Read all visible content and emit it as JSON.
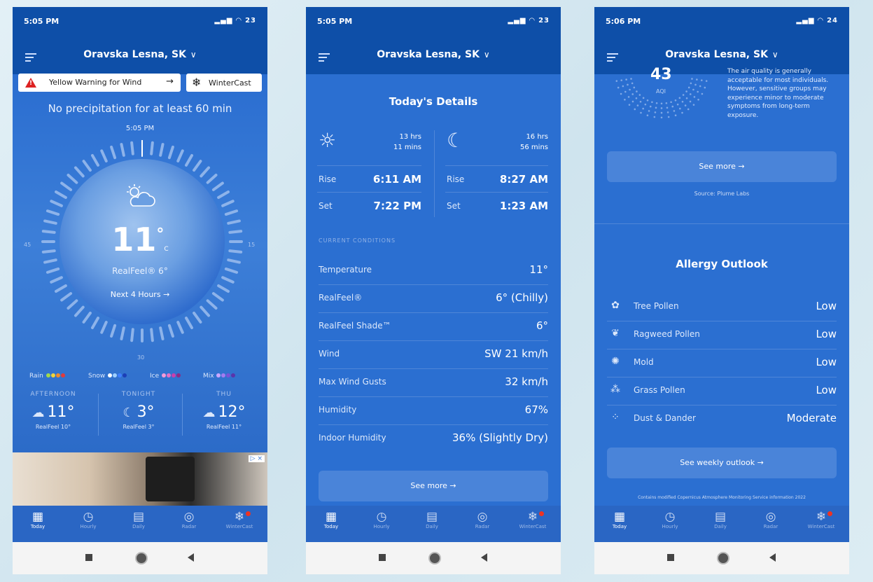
{
  "phones": [
    {
      "status_time": "5:05 PM",
      "battery": "23",
      "location": "Oravska Lesna, SK",
      "warning_label": "Yellow Warning for Wind",
      "wintercast_label": "WinterCast",
      "precip_text": "No precipitation for at least 60 min",
      "dial_time": "5:05 PM",
      "dial_labels": {
        "left": "45",
        "right": "15",
        "bottom": "30"
      },
      "temp": "11",
      "temp_unit": "C",
      "realfeel": "RealFeel® 6°",
      "next_hours": "Next 4 Hours",
      "legend": {
        "rain": "Rain",
        "snow": "Snow",
        "ice": "Ice",
        "mix": "Mix"
      },
      "legend_colors": {
        "rain": [
          "#a3d94a",
          "#f1d33a",
          "#f08a2b",
          "#e23b3b"
        ],
        "snow": [
          "#ffffff",
          "#9fd0ff",
          "#3f7fff",
          "#1c3fb8"
        ],
        "ice": [
          "#f49ad9",
          "#e46fc6",
          "#c93fae",
          "#8d2a86"
        ],
        "mix": [
          "#caa6ff",
          "#a27cf0",
          "#7a52d6",
          "#5a34ab"
        ]
      },
      "forecast": [
        {
          "label": "AFTERNOON",
          "temp": "11°",
          "realfeel": "RealFeel 10°",
          "icon": "rain-cloud-icon"
        },
        {
          "label": "TONIGHT",
          "temp": "3°",
          "realfeel": "RealFeel 3°",
          "icon": "wind-moon-icon"
        },
        {
          "label": "THU",
          "temp": "12°",
          "realfeel": "RealFeel 11°",
          "icon": "rain-cloud-icon"
        }
      ],
      "ad_badge": "▷ ×"
    },
    {
      "status_time": "5:05 PM",
      "battery": "23",
      "location": "Oravska Lesna, SK",
      "title": "Today's Details",
      "sun": {
        "dur1": "13 hrs",
        "dur2": "11 mins",
        "rise_label": "Rise",
        "rise": "6:11 AM",
        "set_label": "Set",
        "set": "7:22 PM"
      },
      "moon": {
        "dur1": "16 hrs",
        "dur2": "56 mins",
        "rise_label": "Rise",
        "rise": "8:27 AM",
        "set_label": "Set",
        "set": "1:23 AM"
      },
      "current_conditions": "CURRENT CONDITIONS",
      "details": [
        {
          "label": "Temperature",
          "value": "11°"
        },
        {
          "label": "RealFeel®",
          "value": "6° (Chilly)"
        },
        {
          "label": "RealFeel Shade™",
          "value": "6°"
        },
        {
          "label": "Wind",
          "value": "SW 21 km/h"
        },
        {
          "label": "Max Wind Gusts",
          "value": "32 km/h"
        },
        {
          "label": "Humidity",
          "value": "67%"
        },
        {
          "label": "Indoor Humidity",
          "value": "36% (Slightly Dry)"
        }
      ],
      "see_more": "See more →"
    },
    {
      "status_time": "5:06 PM",
      "battery": "24",
      "location": "Oravska Lesna, SK",
      "aqi_value": "43",
      "aqi_label": "AQI",
      "aqi_text": "The air quality is generally acceptable for most individuals. However, sensitive groups may experience minor to moderate symptoms from long-term exposure.",
      "see_more": "See more →",
      "source": "Source: Plume Labs",
      "allergy_title": "Allergy Outlook",
      "allergy": [
        {
          "label": "Tree Pollen",
          "value": "Low",
          "icon": "tree-pollen-icon"
        },
        {
          "label": "Ragweed Pollen",
          "value": "Low",
          "icon": "ragweed-icon"
        },
        {
          "label": "Mold",
          "value": "Low",
          "icon": "mold-icon"
        },
        {
          "label": "Grass Pollen",
          "value": "Low",
          "icon": "grass-icon"
        },
        {
          "label": "Dust & Dander",
          "value": "Moderate",
          "icon": "dust-icon"
        }
      ],
      "weekly": "See weekly outlook →",
      "footer": "Contains modified Copernicus Atmosphere Monitoring Service information 2022"
    }
  ],
  "tabs": [
    "Today",
    "Hourly",
    "Daily",
    "Radar",
    "WinterCast"
  ],
  "colors": {
    "header": "#0e4fa8",
    "body": "#2b6fd1",
    "warning_red": "#dd2222"
  }
}
